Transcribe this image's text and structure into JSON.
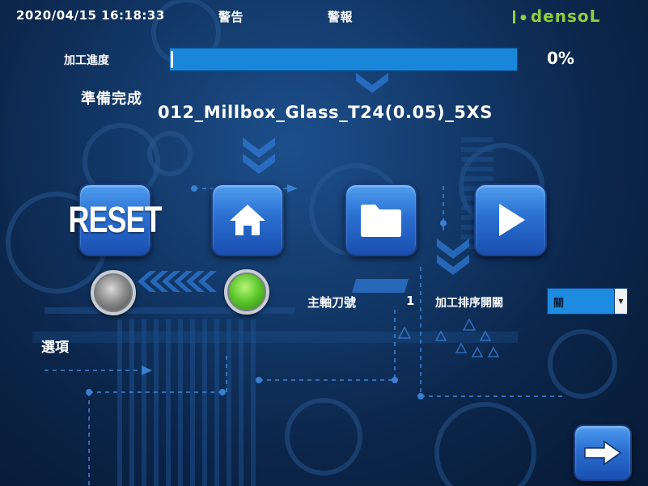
{
  "header": {
    "datetime": "2020/04/15 16:18:33",
    "warning_tab": "警告",
    "alarm_tab": "警報",
    "logo_text": "densoL",
    "logo_color": "#8fce3f"
  },
  "progress": {
    "label": "加工進度",
    "value": 0,
    "percent_text": "0%"
  },
  "job": {
    "status": "準備完成",
    "filename": "012_Millbox_Glass_T24(0.05)_5XS"
  },
  "buttons": {
    "reset_label": "RESET",
    "home_icon": "home-icon",
    "folder_icon": "folder-icon",
    "play_icon": "play-icon",
    "next_icon": "arrow-right-icon"
  },
  "indicators": {
    "lamp1_state": "off",
    "lamp2_state": "on",
    "lamp_on_color": "#5bc72a",
    "lamp_off_color": "#8a8a8a"
  },
  "spindle": {
    "label": "主軸刀號",
    "value": "1"
  },
  "sort_switch": {
    "label": "加工排序開關",
    "selected": "關"
  },
  "options": {
    "label": "選項"
  },
  "accent_color": "#1a86d9"
}
